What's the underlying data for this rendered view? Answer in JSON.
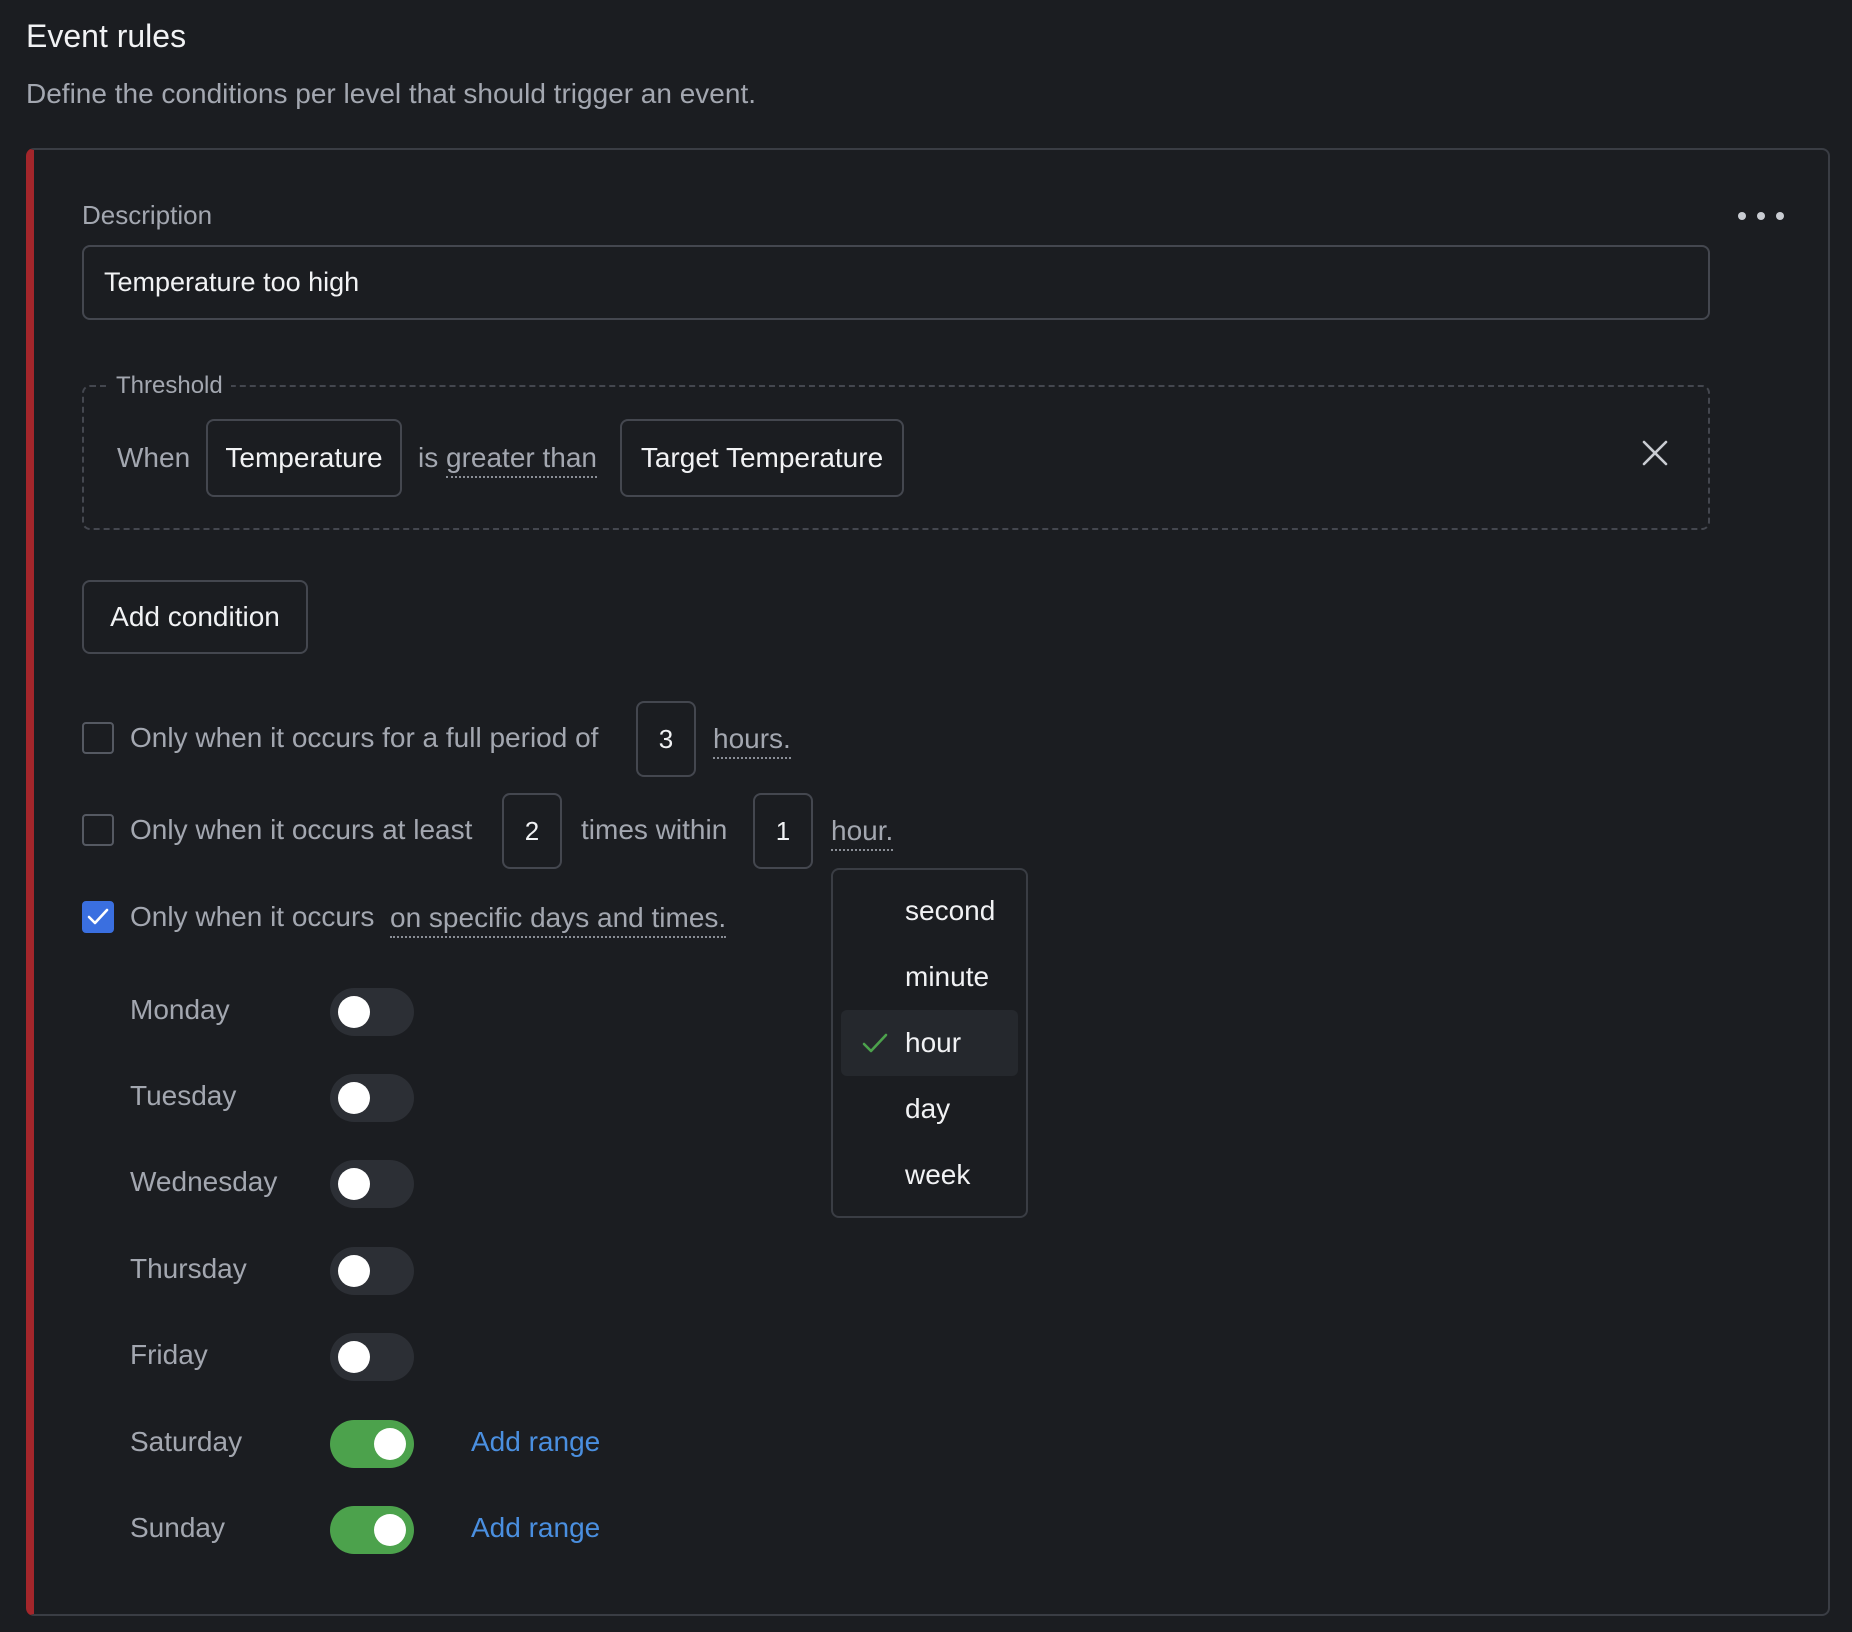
{
  "header": {
    "title": "Event rules",
    "subtitle": "Define the conditions per level that should trigger an event."
  },
  "rule": {
    "accent_color": "#a3262b",
    "description_label": "Description",
    "description_value": "Temperature too high",
    "threshold": {
      "legend": "Threshold",
      "when": "When",
      "left_operand": "Temperature",
      "operator_prefix": "is",
      "operator": "greater than",
      "right_operand": "Target Temperature"
    },
    "add_condition_label": "Add condition",
    "period_option": {
      "checked": false,
      "text": "Only when it occurs for a full period of",
      "value": "3",
      "unit": "hours."
    },
    "frequency_option": {
      "checked": false,
      "text_before": "Only when it occurs at least",
      "count": "2",
      "text_mid": "times within",
      "window": "1",
      "unit": "hour."
    },
    "schedule_option": {
      "checked": true,
      "text_before": "Only when it occurs",
      "link_text": "on specific days and times."
    },
    "days": [
      {
        "name": "Monday",
        "enabled": false
      },
      {
        "name": "Tuesday",
        "enabled": false
      },
      {
        "name": "Wednesday",
        "enabled": false
      },
      {
        "name": "Thursday",
        "enabled": false
      },
      {
        "name": "Friday",
        "enabled": false
      },
      {
        "name": "Saturday",
        "enabled": true,
        "action": "Add range"
      },
      {
        "name": "Sunday",
        "enabled": true,
        "action": "Add range"
      }
    ],
    "unit_dropdown": {
      "options": [
        "second",
        "minute",
        "hour",
        "day",
        "week"
      ],
      "selected": "hour"
    }
  },
  "colors": {
    "checkbox_checked": "#3a6fe0",
    "toggle_on": "#4ca24c",
    "link": "#4a8fe0",
    "check_mark": "#4ca24c"
  }
}
